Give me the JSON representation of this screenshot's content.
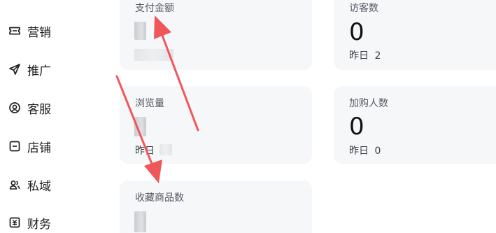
{
  "sidebar": {
    "items": [
      {
        "label": "营销",
        "icon": "ticket-icon"
      },
      {
        "label": "推广",
        "icon": "send-icon"
      },
      {
        "label": "客服",
        "icon": "customer-service-icon"
      },
      {
        "label": "店铺",
        "icon": "store-icon"
      },
      {
        "label": "私域",
        "icon": "users-icon"
      },
      {
        "label": "财务",
        "icon": "finance-icon"
      }
    ]
  },
  "stats": {
    "payment_amount": {
      "title": "支付金额"
    },
    "visitors": {
      "title": "访客数",
      "value": "0",
      "prev_label": "昨日",
      "prev_value": "2"
    },
    "views": {
      "title": "浏览量",
      "prev_label": "昨日"
    },
    "add_to_cart": {
      "title": "加购人数",
      "value": "0",
      "prev_label": "昨日",
      "prev_value": "0"
    },
    "favorites": {
      "title": "收藏商品数"
    }
  },
  "colors": {
    "card_bg": "#f6f7f9",
    "annotation_arrow": "#f0575a",
    "text_primary": "#111111",
    "text_secondary": "#555a63"
  }
}
